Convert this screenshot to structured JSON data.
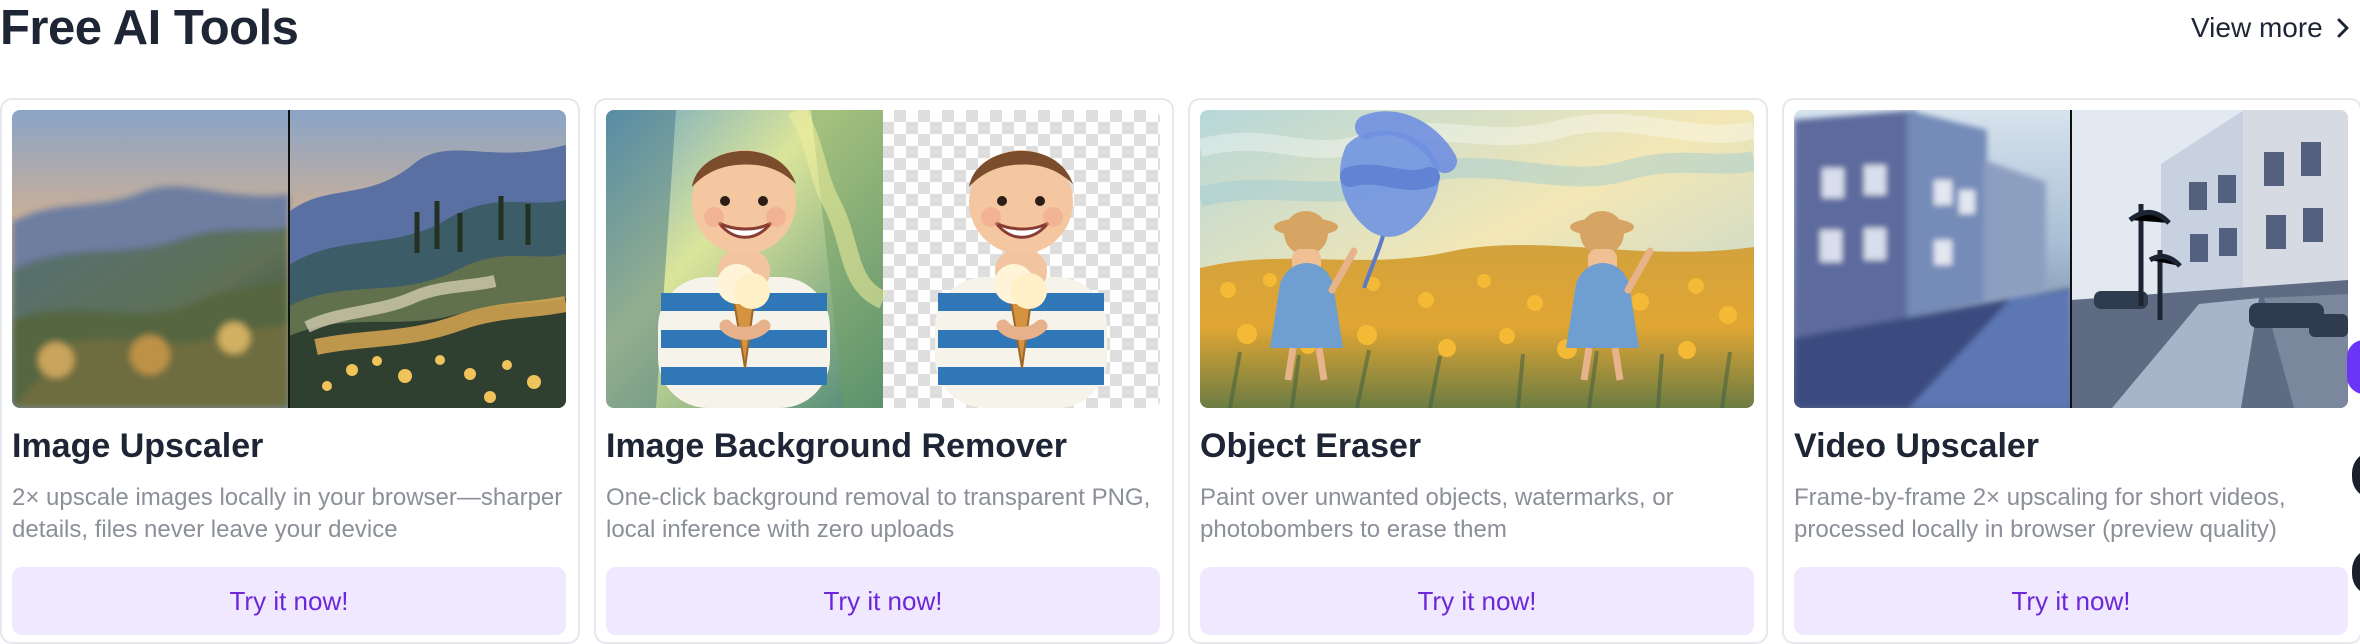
{
  "section": {
    "title": "Free AI Tools",
    "view_more_label": "View more",
    "view_more_icon": "chevron-right-icon"
  },
  "tools": [
    {
      "title": "Image Upscaler",
      "description": "2× upscale images locally in your browser—sharper details, files never leave your device",
      "button_label": "Try it now!",
      "media": "landscape painting before-after upscaling comparison"
    },
    {
      "title": "Image Background Remover",
      "description": "One-click background removal to transparent PNG, local inference with zero uploads",
      "button_label": "Try it now!",
      "media": "boy holding ice cream with original and transparent background"
    },
    {
      "title": "Object Eraser",
      "description": "Paint over unwanted objects, watermarks, or photobombers to erase them",
      "button_label": "Try it now!",
      "media": "girl in flower field with painted object to erase"
    },
    {
      "title": "Video Upscaler",
      "description": "Frame-by-frame 2× upscaling for short videos, processed locally in browser (preview quality)",
      "button_label": "Try it now!",
      "media": "city street video before-after upscaling comparison"
    }
  ],
  "colors": {
    "title_text": "#1e2535",
    "description_text": "#8b8f98",
    "button_background": "#efe8fe",
    "button_text": "#6d27d9",
    "card_border": "#e6e8ee"
  }
}
